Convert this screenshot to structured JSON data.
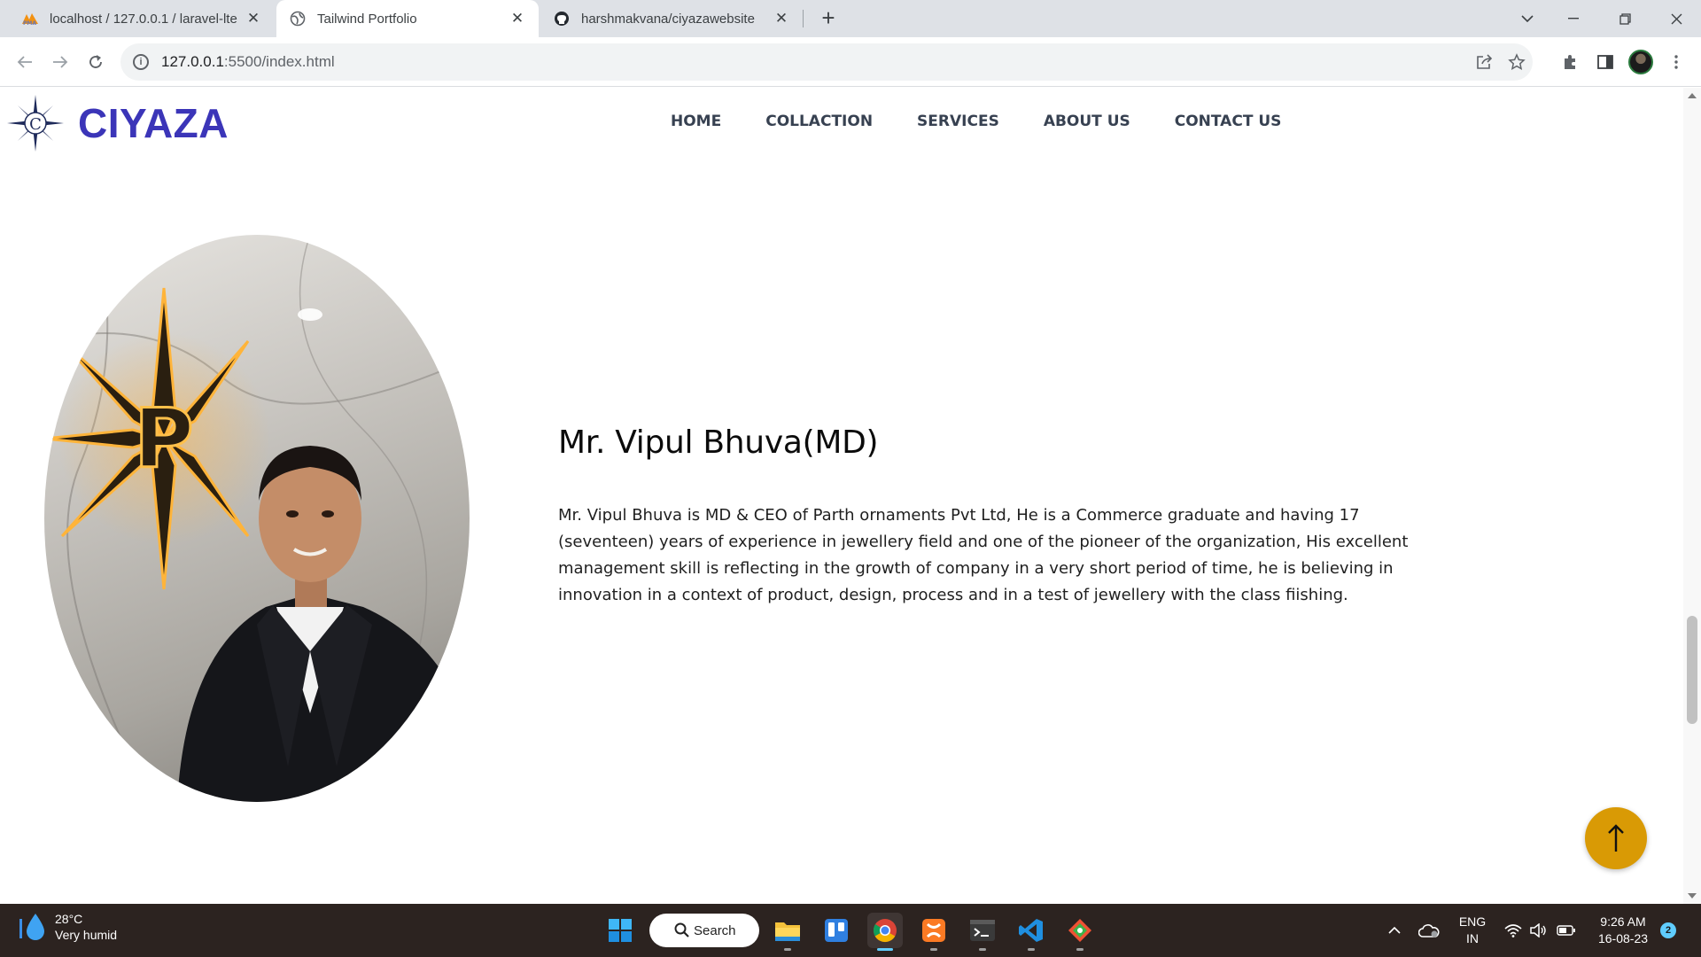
{
  "browser": {
    "tabs": [
      {
        "title": "localhost / 127.0.0.1 / laravel-lte",
        "favicon": "phpmyadmin-icon",
        "active": false
      },
      {
        "title": "Tailwind Portfolio",
        "favicon": "globe-icon",
        "active": true
      },
      {
        "title": "harshmakvana/ciyazawebsite",
        "favicon": "github-icon",
        "active": false
      }
    ],
    "address": {
      "host": "127.0.0.1",
      "rest": ":5500/index.html"
    }
  },
  "site": {
    "brand": "CIYAZA",
    "brand_color": "#3b35b8",
    "nav": [
      "HOME",
      "COLLACTION",
      "SERVICES",
      "ABOUT US",
      "CONTACT US"
    ],
    "profile": {
      "name": "Mr. Vipul Bhuva(MD)",
      "bio": "Mr. Vipul Bhuva is MD & CEO of Parth ornaments Pvt Ltd, He is a Commerce graduate and having 17 (seventeen) years of experience in jewellery field and one of the pioneer of the organization, His excellent management skill is reflecting in the growth of company in a very short period of time, he is believing in innovation in a context of product, design, process and in a test of jewellery with the class fiishing.",
      "logo_letter": "P"
    },
    "scroll_top_color": "#d99a05"
  },
  "taskbar": {
    "weather": {
      "temp": "28°C",
      "condition": "Very humid"
    },
    "search_label": "Search",
    "language": {
      "line1": "ENG",
      "line2": "IN"
    },
    "clock": {
      "time": "9:26 AM",
      "date": "16-08-23"
    },
    "notifications": "2"
  }
}
